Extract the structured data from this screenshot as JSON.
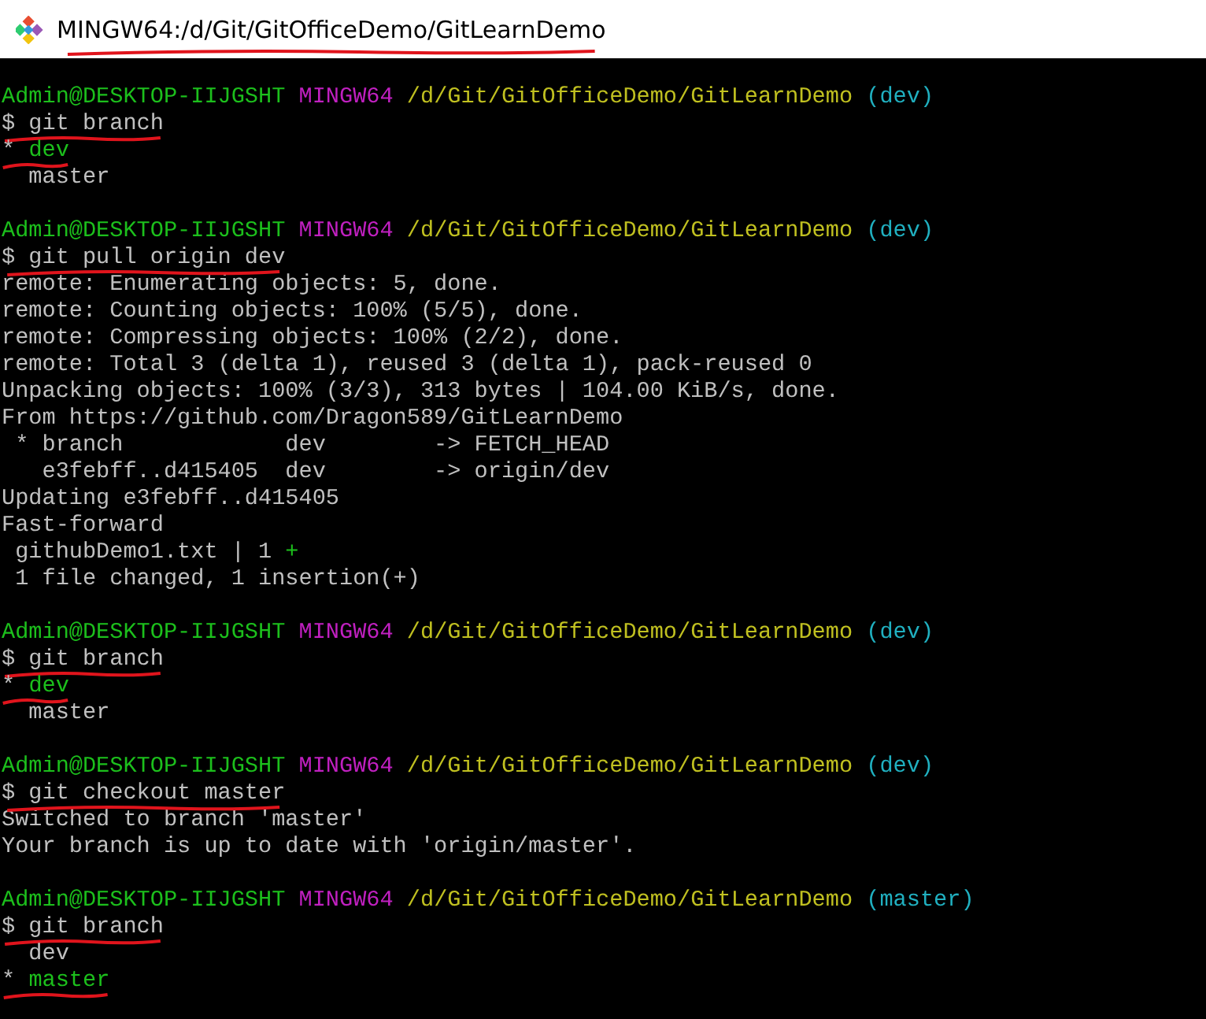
{
  "window": {
    "title": "MINGW64:/d/Git/GitOfficeDemo/GitLearnDemo",
    "title_underlined": true
  },
  "lines": [
    {
      "kind": "blank"
    },
    {
      "kind": "prompt",
      "user": "Admin@DESKTOP-IIJGSHT",
      "system": "MINGW64",
      "path": "/d/Git/GitOfficeDemo/GitLearnDemo",
      "branch": "(dev)"
    },
    {
      "kind": "command",
      "sign": "$",
      "text": "git branch",
      "underlined": true
    },
    {
      "kind": "branch",
      "marker": "*",
      "name": "dev",
      "selected": true,
      "underlined": true
    },
    {
      "kind": "branch",
      "name": "master",
      "selected": false
    },
    {
      "kind": "blank"
    },
    {
      "kind": "prompt",
      "user": "Admin@DESKTOP-IIJGSHT",
      "system": "MINGW64",
      "path": "/d/Git/GitOfficeDemo/GitLearnDemo",
      "branch": "(dev)"
    },
    {
      "kind": "command",
      "sign": "$",
      "text": "git pull origin dev",
      "underlined": true
    },
    {
      "kind": "output",
      "text": "remote: Enumerating objects: 5, done."
    },
    {
      "kind": "output",
      "text": "remote: Counting objects: 100% (5/5), done."
    },
    {
      "kind": "output",
      "text": "remote: Compressing objects: 100% (2/2), done."
    },
    {
      "kind": "output",
      "text": "remote: Total 3 (delta 1), reused 3 (delta 1), pack-reused 0"
    },
    {
      "kind": "output",
      "text": "Unpacking objects: 100% (3/3), 313 bytes | 104.00 KiB/s, done."
    },
    {
      "kind": "output",
      "text": "From https://github.com/Dragon589/GitLearnDemo"
    },
    {
      "kind": "output",
      "text": " * branch            dev        -> FETCH_HEAD"
    },
    {
      "kind": "output",
      "text": "   e3febff..d415405  dev        -> origin/dev"
    },
    {
      "kind": "output",
      "text": "Updating e3febff..d415405"
    },
    {
      "kind": "output",
      "text": "Fast-forward"
    },
    {
      "kind": "stat",
      "text": " githubDemo1.txt | 1 ",
      "plus": "+"
    },
    {
      "kind": "output",
      "text": " 1 file changed, 1 insertion(+)"
    },
    {
      "kind": "blank"
    },
    {
      "kind": "prompt",
      "user": "Admin@DESKTOP-IIJGSHT",
      "system": "MINGW64",
      "path": "/d/Git/GitOfficeDemo/GitLearnDemo",
      "branch": "(dev)"
    },
    {
      "kind": "command",
      "sign": "$",
      "text": "git branch",
      "underlined": true
    },
    {
      "kind": "branch",
      "marker": "*",
      "name": "dev",
      "selected": true,
      "underlined": true
    },
    {
      "kind": "branch",
      "name": "master",
      "selected": false
    },
    {
      "kind": "blank"
    },
    {
      "kind": "prompt",
      "user": "Admin@DESKTOP-IIJGSHT",
      "system": "MINGW64",
      "path": "/d/Git/GitOfficeDemo/GitLearnDemo",
      "branch": "(dev)"
    },
    {
      "kind": "command",
      "sign": "$",
      "text": "git checkout master",
      "underlined": true
    },
    {
      "kind": "output",
      "text": "Switched to branch 'master'"
    },
    {
      "kind": "output",
      "text": "Your branch is up to date with 'origin/master'."
    },
    {
      "kind": "blank"
    },
    {
      "kind": "prompt",
      "user": "Admin@DESKTOP-IIJGSHT",
      "system": "MINGW64",
      "path": "/d/Git/GitOfficeDemo/GitLearnDemo",
      "branch": "(master)"
    },
    {
      "kind": "command",
      "sign": "$",
      "text": "git branch",
      "underlined": true
    },
    {
      "kind": "branch",
      "name": "dev",
      "selected": false
    },
    {
      "kind": "branch",
      "marker": "*",
      "name": "master",
      "selected": true,
      "underlined": true
    }
  ]
}
